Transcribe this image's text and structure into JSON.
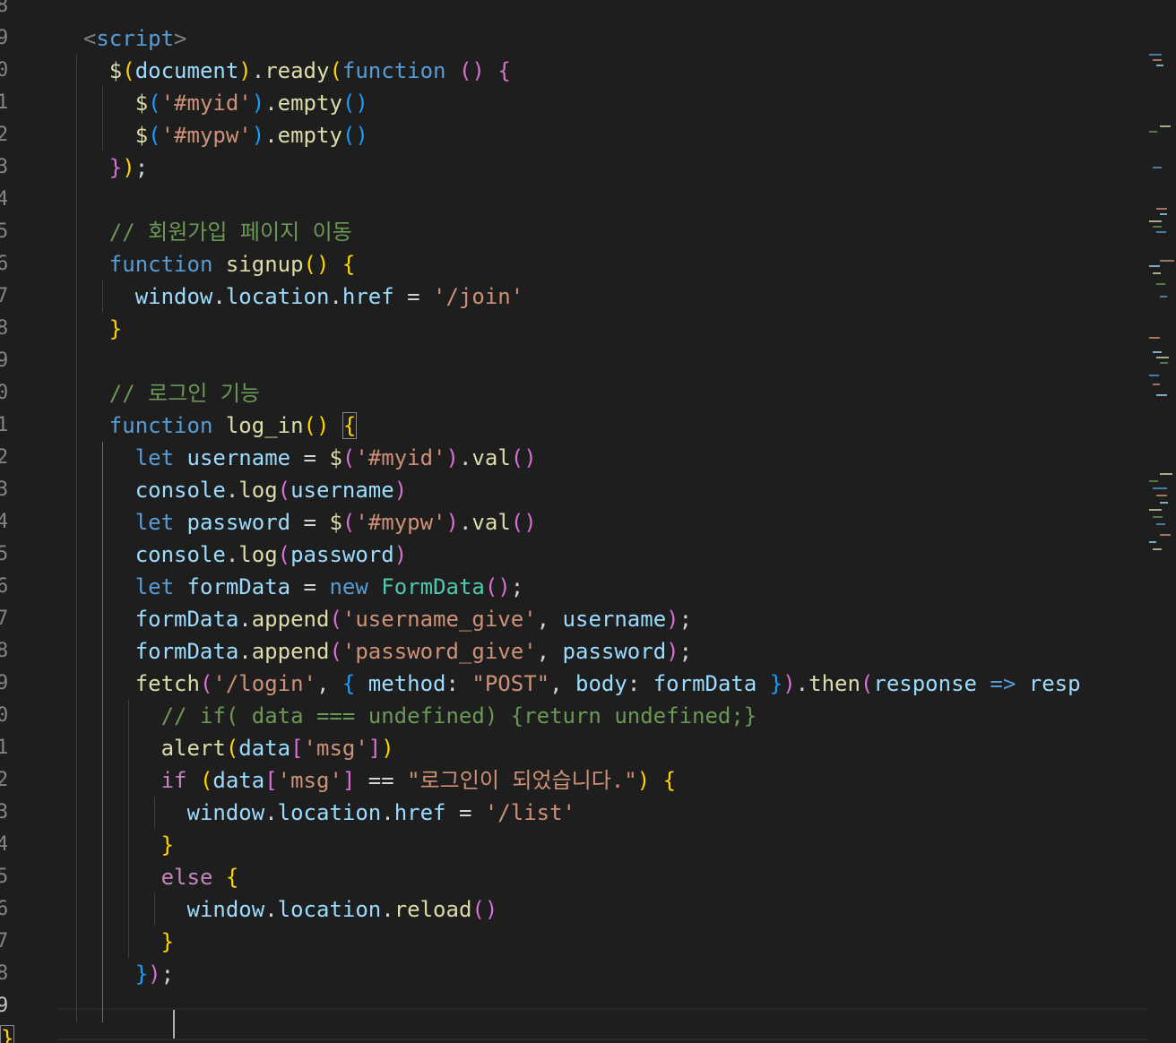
{
  "editor": {
    "line_numbers": [
      "8",
      "9",
      "0",
      "1",
      "2",
      "3",
      "4",
      "5",
      "6",
      "7",
      "8",
      "9",
      "0",
      "1",
      "2",
      "3",
      "4",
      "5",
      "6",
      "7",
      "8",
      "9",
      "0",
      "1",
      "2",
      "3",
      "4",
      "5",
      "6",
      "7",
      "8",
      "9"
    ],
    "current_line_index": 31,
    "lines": [
      [],
      [
        {
          "t": "<",
          "c": "tg"
        },
        {
          "t": "script",
          "c": "kw"
        },
        {
          "t": ">",
          "c": "tg"
        }
      ],
      [
        {
          "t": "$",
          "c": "fn"
        },
        {
          "t": "(",
          "c": "b1"
        },
        {
          "t": "document",
          "c": "vr"
        },
        {
          "t": ")",
          "c": "b1"
        },
        {
          "t": ".",
          "c": "op"
        },
        {
          "t": "ready",
          "c": "fn"
        },
        {
          "t": "(",
          "c": "b1"
        },
        {
          "t": "function",
          "c": "kw"
        },
        {
          "t": " ",
          "c": "op"
        },
        {
          "t": "()",
          "c": "b2"
        },
        {
          "t": " ",
          "c": "op"
        },
        {
          "t": "{",
          "c": "b2"
        }
      ],
      [
        {
          "t": "$",
          "c": "fn"
        },
        {
          "t": "(",
          "c": "b3"
        },
        {
          "t": "'#myid'",
          "c": "st"
        },
        {
          "t": ")",
          "c": "b3"
        },
        {
          "t": ".",
          "c": "op"
        },
        {
          "t": "empty",
          "c": "fn"
        },
        {
          "t": "()",
          "c": "b3"
        }
      ],
      [
        {
          "t": "$",
          "c": "fn"
        },
        {
          "t": "(",
          "c": "b3"
        },
        {
          "t": "'#mypw'",
          "c": "st"
        },
        {
          "t": ")",
          "c": "b3"
        },
        {
          "t": ".",
          "c": "op"
        },
        {
          "t": "empty",
          "c": "fn"
        },
        {
          "t": "()",
          "c": "b3"
        }
      ],
      [
        {
          "t": "}",
          "c": "b2"
        },
        {
          "t": ")",
          "c": "b1"
        },
        {
          "t": ";",
          "c": "op"
        }
      ],
      [],
      [
        {
          "t": "// 회원가입 페이지 이동",
          "c": "cm"
        }
      ],
      [
        {
          "t": "function",
          "c": "kw"
        },
        {
          "t": " ",
          "c": "op"
        },
        {
          "t": "signup",
          "c": "fn"
        },
        {
          "t": "()",
          "c": "b1"
        },
        {
          "t": " ",
          "c": "op"
        },
        {
          "t": "{",
          "c": "b1"
        }
      ],
      [
        {
          "t": "window",
          "c": "vr"
        },
        {
          "t": ".",
          "c": "op"
        },
        {
          "t": "location",
          "c": "vr"
        },
        {
          "t": ".",
          "c": "op"
        },
        {
          "t": "href",
          "c": "vr"
        },
        {
          "t": " = ",
          "c": "op"
        },
        {
          "t": "'/join'",
          "c": "st"
        }
      ],
      [
        {
          "t": "}",
          "c": "b1"
        }
      ],
      [],
      [
        {
          "t": "// 로그인 기능",
          "c": "cm"
        }
      ],
      [
        {
          "t": "function",
          "c": "kw"
        },
        {
          "t": " ",
          "c": "op"
        },
        {
          "t": "log_in",
          "c": "fn"
        },
        {
          "t": "()",
          "c": "b1"
        },
        {
          "t": " ",
          "c": "op"
        },
        {
          "t": "{",
          "c": "b1",
          "box": true
        }
      ],
      [
        {
          "t": "let",
          "c": "kw"
        },
        {
          "t": " ",
          "c": "op"
        },
        {
          "t": "username",
          "c": "vr"
        },
        {
          "t": " = ",
          "c": "op"
        },
        {
          "t": "$",
          "c": "fn"
        },
        {
          "t": "(",
          "c": "b2"
        },
        {
          "t": "'#myid'",
          "c": "st"
        },
        {
          "t": ")",
          "c": "b2"
        },
        {
          "t": ".",
          "c": "op"
        },
        {
          "t": "val",
          "c": "fn"
        },
        {
          "t": "()",
          "c": "b2"
        }
      ],
      [
        {
          "t": "console",
          "c": "vr"
        },
        {
          "t": ".",
          "c": "op"
        },
        {
          "t": "log",
          "c": "fn"
        },
        {
          "t": "(",
          "c": "b2"
        },
        {
          "t": "username",
          "c": "vr"
        },
        {
          "t": ")",
          "c": "b2"
        }
      ],
      [
        {
          "t": "let",
          "c": "kw"
        },
        {
          "t": " ",
          "c": "op"
        },
        {
          "t": "password",
          "c": "vr"
        },
        {
          "t": " = ",
          "c": "op"
        },
        {
          "t": "$",
          "c": "fn"
        },
        {
          "t": "(",
          "c": "b2"
        },
        {
          "t": "'#mypw'",
          "c": "st"
        },
        {
          "t": ")",
          "c": "b2"
        },
        {
          "t": ".",
          "c": "op"
        },
        {
          "t": "val",
          "c": "fn"
        },
        {
          "t": "()",
          "c": "b2"
        }
      ],
      [
        {
          "t": "console",
          "c": "vr"
        },
        {
          "t": ".",
          "c": "op"
        },
        {
          "t": "log",
          "c": "fn"
        },
        {
          "t": "(",
          "c": "b2"
        },
        {
          "t": "password",
          "c": "vr"
        },
        {
          "t": ")",
          "c": "b2"
        }
      ],
      [
        {
          "t": "let",
          "c": "kw"
        },
        {
          "t": " ",
          "c": "op"
        },
        {
          "t": "formData",
          "c": "vr"
        },
        {
          "t": " = ",
          "c": "op"
        },
        {
          "t": "new",
          "c": "kw"
        },
        {
          "t": " ",
          "c": "op"
        },
        {
          "t": "FormData",
          "c": "cl"
        },
        {
          "t": "()",
          "c": "b2"
        },
        {
          "t": ";",
          "c": "op"
        }
      ],
      [
        {
          "t": "formData",
          "c": "vr"
        },
        {
          "t": ".",
          "c": "op"
        },
        {
          "t": "append",
          "c": "fn"
        },
        {
          "t": "(",
          "c": "b2"
        },
        {
          "t": "'username_give'",
          "c": "st"
        },
        {
          "t": ", ",
          "c": "op"
        },
        {
          "t": "username",
          "c": "vr"
        },
        {
          "t": ")",
          "c": "b2"
        },
        {
          "t": ";",
          "c": "op"
        }
      ],
      [
        {
          "t": "formData",
          "c": "vr"
        },
        {
          "t": ".",
          "c": "op"
        },
        {
          "t": "append",
          "c": "fn"
        },
        {
          "t": "(",
          "c": "b2"
        },
        {
          "t": "'password_give'",
          "c": "st"
        },
        {
          "t": ", ",
          "c": "op"
        },
        {
          "t": "password",
          "c": "vr"
        },
        {
          "t": ")",
          "c": "b2"
        },
        {
          "t": ";",
          "c": "op"
        }
      ],
      [
        {
          "t": "fetch",
          "c": "fn"
        },
        {
          "t": "(",
          "c": "b2"
        },
        {
          "t": "'/login'",
          "c": "st"
        },
        {
          "t": ", ",
          "c": "op"
        },
        {
          "t": "{",
          "c": "b3"
        },
        {
          "t": " ",
          "c": "op"
        },
        {
          "t": "method",
          "c": "vr"
        },
        {
          "t": ": ",
          "c": "op"
        },
        {
          "t": "\"POST\"",
          "c": "st"
        },
        {
          "t": ", ",
          "c": "op"
        },
        {
          "t": "body",
          "c": "vr"
        },
        {
          "t": ": ",
          "c": "op"
        },
        {
          "t": "formData",
          "c": "vr"
        },
        {
          "t": " ",
          "c": "op"
        },
        {
          "t": "}",
          "c": "b3"
        },
        {
          "t": ")",
          "c": "b2"
        },
        {
          "t": ".",
          "c": "op"
        },
        {
          "t": "then",
          "c": "fn"
        },
        {
          "t": "(",
          "c": "b2"
        },
        {
          "t": "response",
          "c": "vr"
        },
        {
          "t": " ",
          "c": "op"
        },
        {
          "t": "=>",
          "c": "kw"
        },
        {
          "t": " ",
          "c": "op"
        },
        {
          "t": "resp",
          "c": "vr"
        }
      ],
      [
        {
          "t": "// if( data === undefined) {return undefined;}",
          "c": "cm"
        }
      ],
      [
        {
          "t": "alert",
          "c": "fn"
        },
        {
          "t": "(",
          "c": "b1"
        },
        {
          "t": "data",
          "c": "vr"
        },
        {
          "t": "[",
          "c": "b2"
        },
        {
          "t": "'msg'",
          "c": "st"
        },
        {
          "t": "]",
          "c": "b2"
        },
        {
          "t": ")",
          "c": "b1"
        }
      ],
      [
        {
          "t": "if",
          "c": "ctl"
        },
        {
          "t": " ",
          "c": "op"
        },
        {
          "t": "(",
          "c": "b1"
        },
        {
          "t": "data",
          "c": "vr"
        },
        {
          "t": "[",
          "c": "b2"
        },
        {
          "t": "'msg'",
          "c": "st"
        },
        {
          "t": "]",
          "c": "b2"
        },
        {
          "t": " == ",
          "c": "op"
        },
        {
          "t": "\"로그인이 되었습니다.\"",
          "c": "st"
        },
        {
          "t": ")",
          "c": "b1"
        },
        {
          "t": " ",
          "c": "op"
        },
        {
          "t": "{",
          "c": "b1"
        }
      ],
      [
        {
          "t": "window",
          "c": "vr"
        },
        {
          "t": ".",
          "c": "op"
        },
        {
          "t": "location",
          "c": "vr"
        },
        {
          "t": ".",
          "c": "op"
        },
        {
          "t": "href",
          "c": "vr"
        },
        {
          "t": " = ",
          "c": "op"
        },
        {
          "t": "'/list'",
          "c": "st"
        }
      ],
      [
        {
          "t": "}",
          "c": "b1"
        }
      ],
      [
        {
          "t": "else",
          "c": "ctl"
        },
        {
          "t": " ",
          "c": "op"
        },
        {
          "t": "{",
          "c": "b1"
        }
      ],
      [
        {
          "t": "window",
          "c": "vr"
        },
        {
          "t": ".",
          "c": "op"
        },
        {
          "t": "location",
          "c": "vr"
        },
        {
          "t": ".",
          "c": "op"
        },
        {
          "t": "reload",
          "c": "fn"
        },
        {
          "t": "()",
          "c": "b2"
        }
      ],
      [
        {
          "t": "}",
          "c": "b1"
        }
      ],
      [
        {
          "t": "}",
          "c": "b3"
        },
        {
          "t": ")",
          "c": "b2"
        },
        {
          "t": ";",
          "c": "op"
        }
      ],
      [],
      [
        {
          "t": "}",
          "c": "b1",
          "box": true
        }
      ]
    ]
  },
  "colors": {
    "background": "#1e1e1e",
    "keyword": "#569cd6",
    "function": "#dcdcaa",
    "variable": "#9cdcfe",
    "string": "#ce9178",
    "comment": "#6a9955",
    "class": "#4ec9b0",
    "bracket_gold": "#ffd700",
    "bracket_orchid": "#da70d6",
    "bracket_blue": "#179fff"
  }
}
